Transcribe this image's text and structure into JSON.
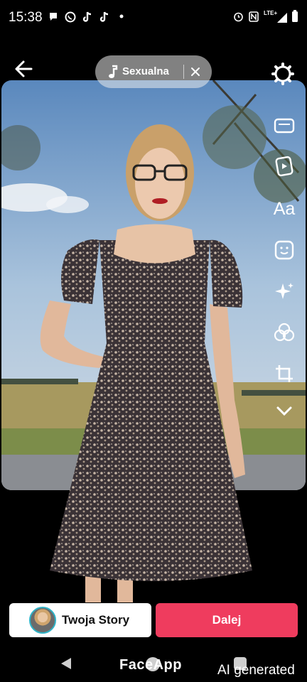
{
  "status_bar": {
    "time": "15:38",
    "right_icons": [
      "alarm-icon",
      "nfc-icon",
      "lte-icon",
      "signal-icon",
      "battery-icon"
    ],
    "left_icons": [
      "message-icon",
      "whatsapp-icon",
      "tiktok-icon",
      "tiktok-icon",
      "dot-icon"
    ],
    "lte": "LTE+"
  },
  "music": {
    "title": "Sexualna"
  },
  "tools": [
    "stickers-icon",
    "clip-icon",
    "text-icon",
    "sticker-face-icon",
    "effects-icon",
    "filters-icon",
    "crop-icon",
    "chevron-down-icon"
  ],
  "tool_text": "Aa",
  "buttons": {
    "story": "Twoja Story",
    "next": "Dalej"
  },
  "watermarks": {
    "app": "FaceApp",
    "ai": "AI generated"
  },
  "colors": {
    "next_button": "#ef3c5e",
    "avatar_ring": "#2fb3c7"
  }
}
